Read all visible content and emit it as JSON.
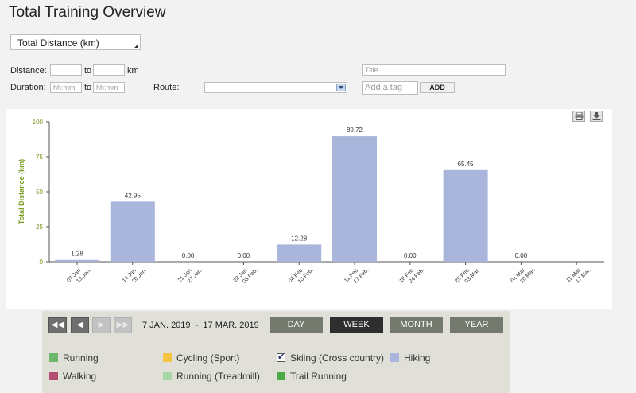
{
  "page_title": "Total Training Overview",
  "metric_select": {
    "selected": "Total Distance (km)"
  },
  "filters": {
    "distance_label": "Distance:",
    "to_label_1": "to",
    "km_label": "km",
    "duration_label": "Duration:",
    "to_label_2": "to",
    "duration_from_placeholder": "hh:mm",
    "duration_to_placeholder": "hh:mm",
    "route_label": "Route:",
    "route_value": "",
    "title_placeholder": "Title",
    "tag_placeholder": "Add a tag",
    "add_label": "ADD"
  },
  "toolbar_icons": [
    "printer-icon",
    "download-icon"
  ],
  "colors": {
    "bar": "#a9b5da",
    "axis_text": "#7a9a22",
    "nav_panel": "#e0e0d8"
  },
  "chart_data": {
    "type": "bar",
    "ylabel": "Total Distance (km)",
    "ylim": [
      0,
      100
    ],
    "yticks": [
      0,
      25,
      50,
      75,
      100
    ],
    "categories": [
      [
        "07 Jan.",
        "13 Jan."
      ],
      [
        "14 Jan.",
        "20 Jan."
      ],
      [
        "21 Jan.",
        "27 Jan."
      ],
      [
        "28 Jan.",
        "03 Feb."
      ],
      [
        "04 Feb.",
        "10 Feb."
      ],
      [
        "11 Feb.",
        "17 Feb."
      ],
      [
        "18 Feb.",
        "24 Feb."
      ],
      [
        "25 Feb.",
        "03 Mar."
      ],
      [
        "04 Mar.",
        "10 Mar."
      ],
      [
        "11 Mar.",
        "17 Mar."
      ]
    ],
    "values": [
      1.28,
      42.95,
      0.0,
      0.0,
      12.28,
      89.72,
      0.0,
      65.45,
      0.0,
      null
    ],
    "value_labels": [
      "1.28",
      "42.95",
      "0.00",
      "0.00",
      "12.28",
      "89.72",
      "0.00",
      "65.45",
      "0.00",
      ""
    ]
  },
  "navigation": {
    "first_icon": "double-left-arrow-icon",
    "prev_icon": "left-arrow-icon",
    "next_icon": "right-arrow-icon",
    "last_icon": "double-right-arrow-icon",
    "date_range": "7 JAN. 2019  -  17 MAR. 2019",
    "periods": [
      "DAY",
      "WEEK",
      "MONTH",
      "YEAR"
    ],
    "active_period": "WEEK"
  },
  "legend": [
    {
      "label": "Running",
      "color": "#6db76a",
      "checked": false
    },
    {
      "label": "Cycling (Sport)",
      "color": "#f4c542",
      "checked": false
    },
    {
      "label": "Skiing (Cross country)",
      "color": "#ffffff",
      "checked": true
    },
    {
      "label": "Hiking",
      "color": "#a9b5da",
      "checked": false
    },
    {
      "label": "Walking",
      "color": "#b24d6e",
      "checked": false
    },
    {
      "label": "Running (Treadmill)",
      "color": "#a8d6a4",
      "checked": false
    },
    {
      "label": "Trail Running",
      "color": "#4caa48",
      "checked": false
    }
  ]
}
